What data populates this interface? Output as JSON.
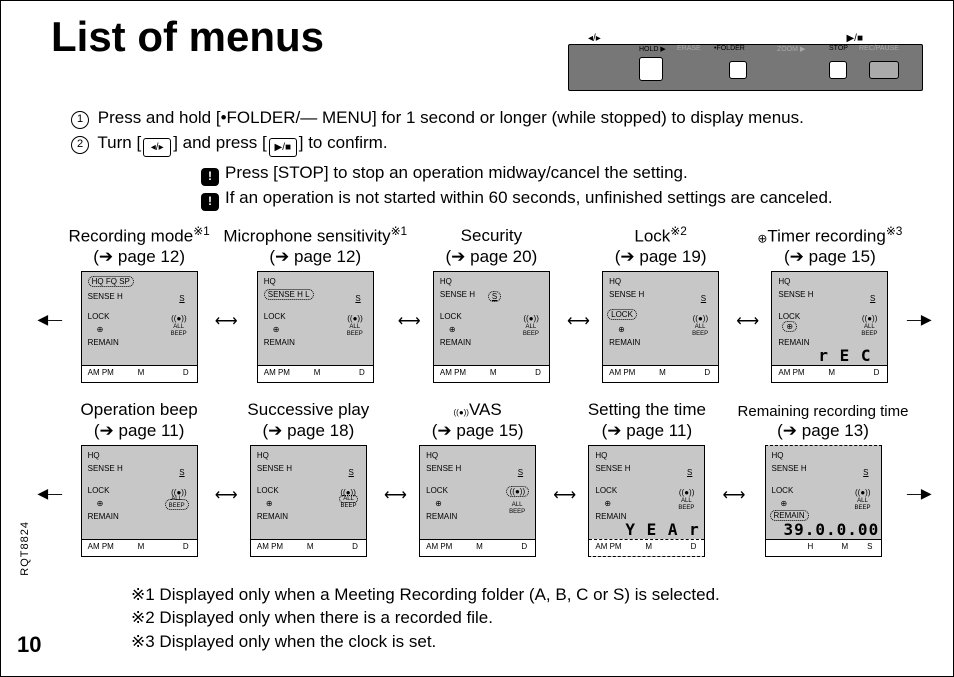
{
  "title": "List of menus",
  "device": {
    "top_left": "◂/▸",
    "top_right": "▶/■",
    "labels": {
      "hold": "HOLD ▶",
      "erase": "ERASE",
      "folder": "•FOLDER",
      "zoom": "ZOOM ▶",
      "stop": "STOP",
      "recpause": "REC/PAUSE"
    }
  },
  "instructions": {
    "step1_pre": "Press and hold [",
    "step1_btn": "•FOLDER/— MENU",
    "step1_post": "] for 1 second or longer (while stopped) to display menus.",
    "step2_pre": "Turn [",
    "step2_mid": "] and press [",
    "step2_post": "] to confirm.",
    "note1": "Press [STOP] to stop an operation midway/cancel the setting.",
    "note2": "If an operation is not started within 60 seconds, unfinished settings are canceled."
  },
  "row1": [
    {
      "l1": "Recording mode",
      "sup": "※1",
      "l2": "(➔ page 12)"
    },
    {
      "l1": "Microphone sensitivity",
      "sup": "※1",
      "l2": "(➔ page 12)"
    },
    {
      "l1": "Security",
      "sup": "",
      "l2": "(➔ page 20)"
    },
    {
      "l1": "Lock",
      "sup": "※2",
      "l2": "(➔ page 19)"
    },
    {
      "l1": "Timer recording",
      "sup": "※3",
      "l2": "(➔ page 15)",
      "clockicon": true
    }
  ],
  "row2": [
    {
      "l1": "Operation beep",
      "sup": "",
      "l2": "(➔ page 11)"
    },
    {
      "l1": "Successive play",
      "sup": "",
      "l2": "(➔ page 18)"
    },
    {
      "l1": "VAS",
      "sup": "",
      "l2": "(➔ page 15)",
      "vasicon": true
    },
    {
      "l1": "Setting the time",
      "sup": "",
      "l2": "(➔ page 11)"
    },
    {
      "l1": "Remaining recording time",
      "sup": "",
      "l2": "(➔ page 13)"
    }
  ],
  "screen_common": {
    "hq": "HQ",
    "fqsp": "FQ SP",
    "sense": "SENSE",
    "h": "H",
    "l": "L",
    "s": "S",
    "lock": "LOCK",
    "remain": "REMAIN",
    "all": "ALL",
    "beep": "BEEP",
    "ampm": "AM PM",
    "m": "M",
    "d": "D",
    "h_b": "H",
    "m_b": "M",
    "s_b": "S",
    "rec": "r E C",
    "year": "Y E A r",
    "time": "39.0.0.00"
  },
  "footnotes": {
    "f1": "※1 Displayed only when a Meeting Recording folder (A, B, C or S) is selected.",
    "f2": "※2 Displayed only when there is a recorded file.",
    "f3": "※3 Displayed only when the clock is set."
  },
  "doc_id": "RQT8824",
  "page_num": "10"
}
